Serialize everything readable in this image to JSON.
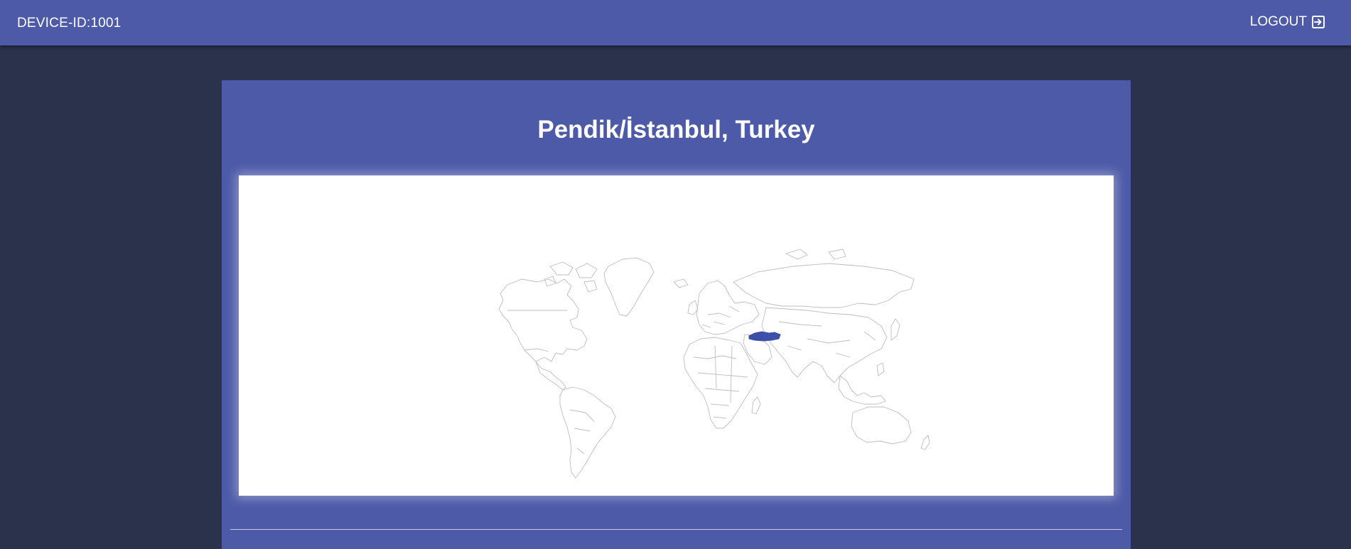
{
  "header": {
    "device_id": "DEVICE-ID:1001",
    "logout_label": "LOGOUT",
    "logout_icon": "logout-icon"
  },
  "main": {
    "location_title": "Pendik/İstanbul, Turkey",
    "map": {
      "highlighted_country": "Turkey"
    }
  },
  "colors": {
    "header_bg": "#4d5aa8",
    "page_bg": "#2b324b",
    "card_bg": "#4d5aa8",
    "highlight": "#3d4fa8",
    "map_stroke": "#b8b8b8"
  }
}
